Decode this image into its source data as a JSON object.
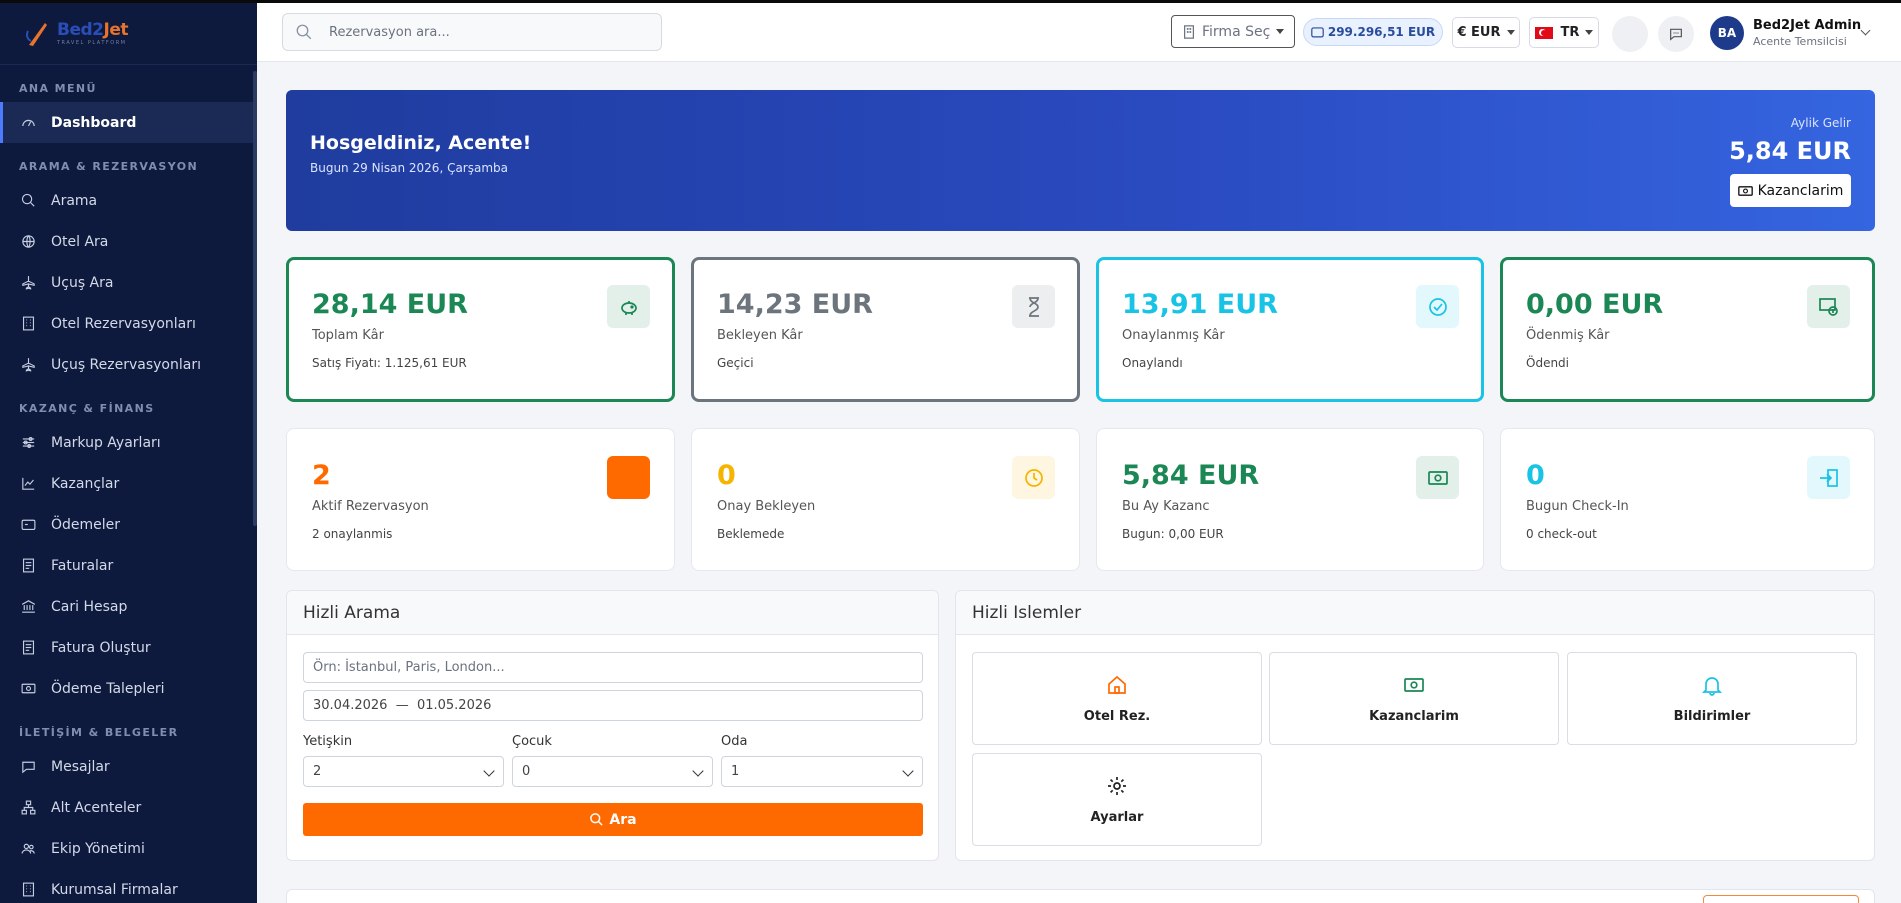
{
  "brand": {
    "name_a": "Bed2",
    "name_b": "Jet",
    "tagline": "TRAVEL PLATFORM"
  },
  "sidebar": {
    "sections": [
      {
        "title": "ANA MENÜ",
        "items": [
          {
            "label": "Dashboard",
            "icon": "gauge-icon",
            "active": true
          }
        ]
      },
      {
        "title": "ARAMA & REZERVASYON",
        "items": [
          {
            "label": "Arama",
            "icon": "search-icon"
          },
          {
            "label": "Otel Ara",
            "icon": "globe-icon"
          },
          {
            "label": "Uçuş Ara",
            "icon": "plane-icon"
          },
          {
            "label": "Otel Rezervasyonları",
            "icon": "building-icon"
          },
          {
            "label": "Uçuş Rezervasyonları",
            "icon": "plane-icon"
          }
        ]
      },
      {
        "title": "KAZANÇ & FİNANS",
        "items": [
          {
            "label": "Markup Ayarları",
            "icon": "sliders-icon"
          },
          {
            "label": "Kazançlar",
            "icon": "chart-icon"
          },
          {
            "label": "Ödemeler",
            "icon": "wallet-icon"
          },
          {
            "label": "Faturalar",
            "icon": "receipt-icon"
          },
          {
            "label": "Cari Hesap",
            "icon": "bank-icon"
          },
          {
            "label": "Fatura Oluştur",
            "icon": "receipt-icon"
          },
          {
            "label": "Ödeme Talepleri",
            "icon": "cash-icon"
          }
        ]
      },
      {
        "title": "İLETİŞİM & BELGELER",
        "items": [
          {
            "label": "Mesajlar",
            "icon": "chat-icon"
          },
          {
            "label": "Alt Acenteler",
            "icon": "diagram-icon"
          },
          {
            "label": "Ekip Yönetimi",
            "icon": "team-icon"
          },
          {
            "label": "Kurumsal Firmalar",
            "icon": "building-icon"
          }
        ]
      }
    ]
  },
  "topbar": {
    "search_placeholder": "Rezervasyon ara...",
    "firma_label": "Firma Seç",
    "balance": "299.296,51 EUR",
    "currency": "€ EUR",
    "language": "TR",
    "user_name": "Bed2Jet Admin",
    "user_role": "Acente Temsilcisi",
    "user_initials": "BA"
  },
  "hero": {
    "title": "Hosgeldiniz, Acente!",
    "subtitle": "Bugun 29 Nisan 2026, Çarşamba",
    "income_label": "Aylik Gelir",
    "income_value": "5,84 EUR",
    "button": "Kazanclarim"
  },
  "stats_row1": [
    {
      "value": "28,14 EUR",
      "label": "Toplam Kâr",
      "sub": "Satış Fiyatı: 1.125,61 EUR",
      "color": "#1a8754",
      "icon": "piggy-bank-icon"
    },
    {
      "value": "14,23 EUR",
      "label": "Bekleyen Kâr",
      "sub": "Geçici",
      "color": "#6c757d",
      "icon": "hourglass-icon"
    },
    {
      "value": "13,91 EUR",
      "label": "Onaylanmış Kâr",
      "sub": "Onaylandı",
      "color": "#19c3e6",
      "icon": "check-circle-icon"
    },
    {
      "value": "0,00 EUR",
      "label": "Ödenmiş Kâr",
      "sub": "Ödendi",
      "color": "#1a8754",
      "icon": "cash-coin-icon"
    }
  ],
  "stats_row2": [
    {
      "value": "2",
      "label": "Aktif Rezervasyon",
      "sub": "2 onaylanmis",
      "color": "#ff6a00",
      "icon": "calendar-icon"
    },
    {
      "value": "0",
      "label": "Onay Bekleyen",
      "sub": "Beklemede",
      "color": "#f5b400",
      "icon": "clock-icon"
    },
    {
      "value": "5,84 EUR",
      "label": "Bu Ay Kazanc",
      "sub": "Bugun: 0,00 EUR",
      "color": "#1a8754",
      "icon": "cash-icon"
    },
    {
      "value": "0",
      "label": "Bugun Check-In",
      "sub": "0 check-out",
      "color": "#19c3e6",
      "icon": "login-icon"
    }
  ],
  "quick_search": {
    "title": "Hizli Arama",
    "destination_placeholder": "Örn: İstanbul, Paris, London...",
    "dates": "30.04.2026  —  01.05.2026",
    "adult_label": "Yetişkin",
    "adult_value": "2",
    "child_label": "Çocuk",
    "child_value": "0",
    "room_label": "Oda",
    "room_value": "1",
    "button": "Ara"
  },
  "quick_actions": {
    "title": "Hizli Islemler",
    "tiles": [
      {
        "label": "Otel Rez.",
        "icon": "home-icon",
        "color": "#ff6a00"
      },
      {
        "label": "Kazanclarim",
        "icon": "cash-icon",
        "color": "#1a8754"
      },
      {
        "label": "Bildirimler",
        "icon": "bell-icon",
        "color": "#19c3e6"
      },
      {
        "label": "Ayarlar",
        "icon": "gear-icon",
        "color": "#222222"
      }
    ]
  }
}
